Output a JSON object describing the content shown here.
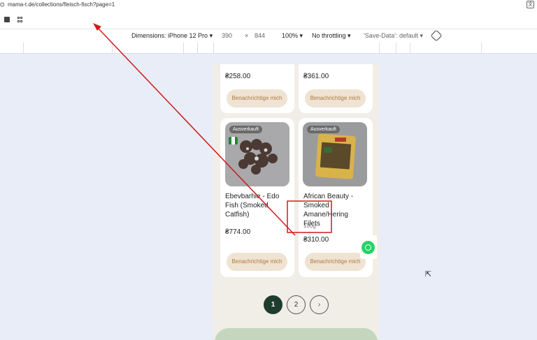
{
  "address_bar": {
    "url": "mama-t.de/collections/fleisch-fisch?page=1"
  },
  "emulation": {
    "dimensions_label": "Dimensions: iPhone 12 Pro",
    "width": "390",
    "times": "×",
    "height": "844",
    "zoom": "100%",
    "throttling": "No throttling",
    "save_data": "'Save-Data': default"
  },
  "products_top": [
    {
      "price": "₴258.00",
      "button": "Benachrichtige mich"
    },
    {
      "price": "₴361.00",
      "button": "Benachrichtige mich"
    }
  ],
  "products": [
    {
      "badge": "Ausverkauft",
      "title": "Ebevbarhie - Edo Fish (Smoked Catfish)",
      "price": "₴774.00",
      "button": "Benachrichtige mich",
      "flag": "nigeria-flag"
    },
    {
      "badge": "Ausverkauft",
      "title": "African Beauty - Smoked Amane/Hering Filets",
      "weight": "100g",
      "price": "₴310.00",
      "button": "Benachrichtige mich"
    }
  ],
  "pagination": {
    "pages": [
      "1",
      "2"
    ],
    "current": "1",
    "next_icon": "chevron-right-icon"
  },
  "colors": {
    "brand_dark_green": "#1f3d2e",
    "notify_bg": "#efe3d3",
    "notify_text": "#b0793e",
    "whatsapp": "#25d366",
    "annotation_red": "#d11a1a"
  }
}
